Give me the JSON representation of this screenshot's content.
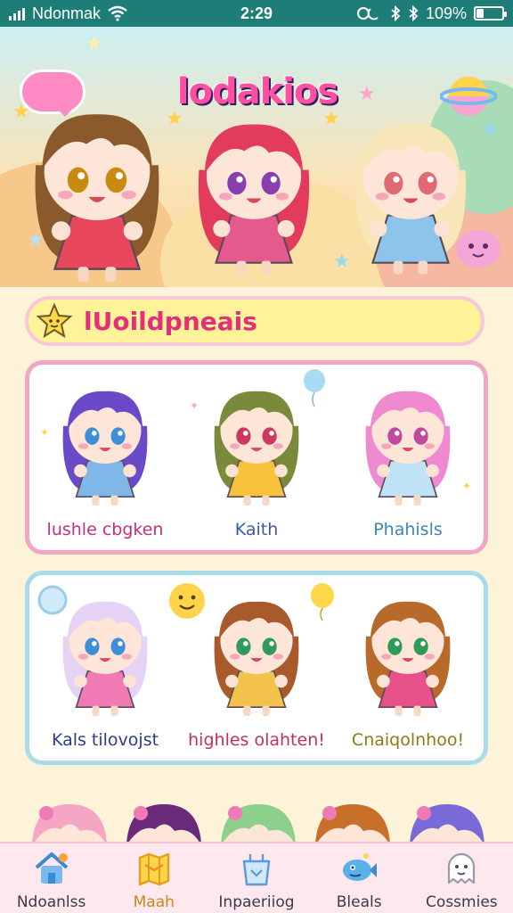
{
  "status_bar": {
    "carrier": "Ndonmak",
    "time": "2:29",
    "battery": "109%",
    "indicators": [
      "signal-bars-icon",
      "wifi-icon",
      "sync-icon",
      "bluetooth-icon",
      "bluetooth-icon",
      "battery-icon"
    ]
  },
  "hero": {
    "logo_text": "lodakios",
    "characters": [
      {
        "hair": "#8a5a2b",
        "dress": "#e8475c",
        "eyes": "#c98a12"
      },
      {
        "hair": "#e33b5c",
        "dress": "#e45a8c",
        "eyes": "#8a3fb0"
      },
      {
        "hair": "#f6e6b8",
        "dress": "#8cc4ea",
        "eyes": "#e06a74"
      }
    ]
  },
  "section": {
    "title": "lUoildpneais"
  },
  "cards": [
    {
      "border": "#f3a6c4",
      "characters": [
        {
          "name": "lushle cbgken",
          "name_color": "#c4307a",
          "hair": "#6a4ac9",
          "outfit": "#7fb8e8",
          "eyes": "#3f8fd8"
        },
        {
          "name": "Kaith",
          "name_color": "#3a5aa8",
          "hair": "#7b8a3a",
          "outfit": "#f7c23a",
          "eyes": "#c93a5c"
        },
        {
          "name": "Phahisls",
          "name_color": "#3f84b8",
          "hair": "#f08ad0",
          "outfit": "#bfe2f6",
          "eyes": "#c04aa0"
        }
      ]
    },
    {
      "border": "#a9dbe8",
      "characters": [
        {
          "name": "Kals tilovojst",
          "name_color": "#2f3a8a",
          "hair": "#e6d2f4",
          "outfit": "#f07ab4",
          "eyes": "#3f8fd8"
        },
        {
          "name": "highles olahten!",
          "name_color": "#c4305a",
          "hair": "#a85a2a",
          "outfit": "#f2c24a",
          "eyes": "#2f9a5a"
        },
        {
          "name": "Cnaiqolnhoo!",
          "name_color": "#8a7a1a",
          "hair": "#b86a2a",
          "outfit": "#e8508a",
          "eyes": "#2f9a5a"
        }
      ]
    }
  ],
  "peek_row": {
    "hair_colors": [
      "#f4a6c4",
      "#6a2a7a",
      "#8cd08c",
      "#c8702a",
      "#7a6ad8"
    ]
  },
  "bottom_nav": {
    "items": [
      {
        "label": "Ndoanlss",
        "icon": "house-icon",
        "active": false
      },
      {
        "label": "Maah",
        "icon": "map-icon",
        "active": true
      },
      {
        "label": "Inpaeriiog",
        "icon": "bag-icon",
        "active": false
      },
      {
        "label": "Bleals",
        "icon": "fish-icon",
        "active": false
      },
      {
        "label": "Cossmies",
        "icon": "ghost-icon",
        "active": false
      }
    ]
  },
  "colors": {
    "status_bar": "#1f7d78",
    "accent_pink": "#e2307a",
    "title_bar": "#fff39a",
    "nav_bg": "#fde8ee"
  }
}
